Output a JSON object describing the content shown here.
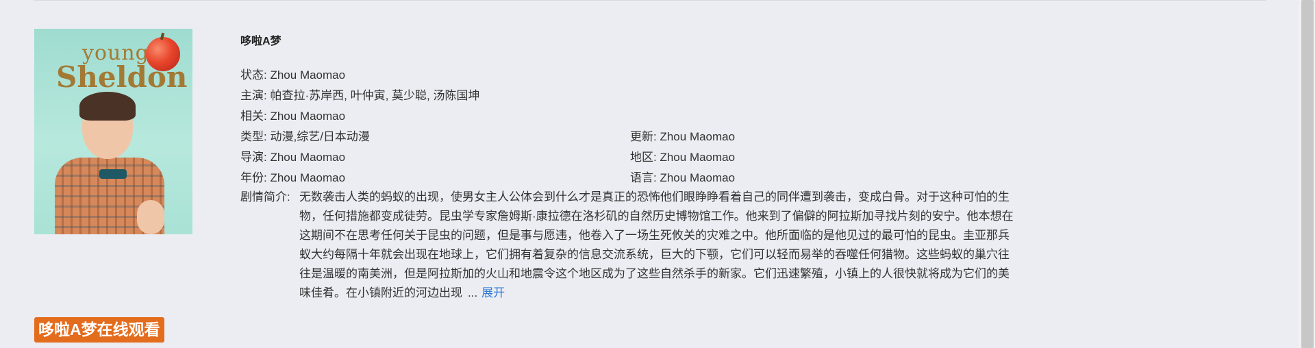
{
  "poster": {
    "logo_line1": "young",
    "logo_line2": "Sheldon"
  },
  "title": "哆啦A梦",
  "fields": {
    "status": {
      "label": "状态:",
      "value": "Zhou Maomao"
    },
    "cast": {
      "label": "主演:",
      "value": "帕查拉·苏岸西, 叶仲寅, 莫少聪, 汤陈国坤"
    },
    "related": {
      "label": "相关:",
      "value": "Zhou Maomao"
    },
    "genre": {
      "label": "类型:",
      "value": "动漫,综艺/日本动漫"
    },
    "updated": {
      "label": "更新:",
      "value": "Zhou Maomao"
    },
    "director": {
      "label": "导演:",
      "value": "Zhou Maomao"
    },
    "region": {
      "label": "地区:",
      "value": "Zhou Maomao"
    },
    "year": {
      "label": "年份:",
      "value": "Zhou Maomao"
    },
    "language": {
      "label": "语言:",
      "value": "Zhou Maomao"
    }
  },
  "synopsis": {
    "label": "剧情简介:",
    "text": "无数袭击人类的蚂蚁的出现，使男女主人公体会到什么才是真正的恐怖他们眼睁睁看着自己的同伴遭到袭击，变成白骨。对于这种可怕的生物，任何措施都变成徒劳。昆虫学专家詹姆斯·康拉德在洛杉矶的自然历史博物馆工作。他来到了偏僻的阿拉斯加寻找片刻的安宁。他本想在这期间不在思考任何关于昆虫的问题，但是事与愿违，他卷入了一场生死攸关的灾难之中。他所面临的是他见过的最可怕的昆虫。圭亚那兵蚁大约每隔十年就会出现在地球上，它们拥有着复杂的信息交流系统，巨大的下颚，它们可以轻而易举的吞噬任何猎物。这些蚂蚁的巢穴往往是温暖的南美洲，但是阿拉斯加的火山和地震令这个地区成为了这些自然杀手的新家。它们迅速繁殖，小镇上的人很快就将成为它们的美味佳肴。在小镇附近的河边出现",
    "ellipsis": "...",
    "expand_label": "展开"
  },
  "watch_button_label": "哆啦A梦在线观看"
}
